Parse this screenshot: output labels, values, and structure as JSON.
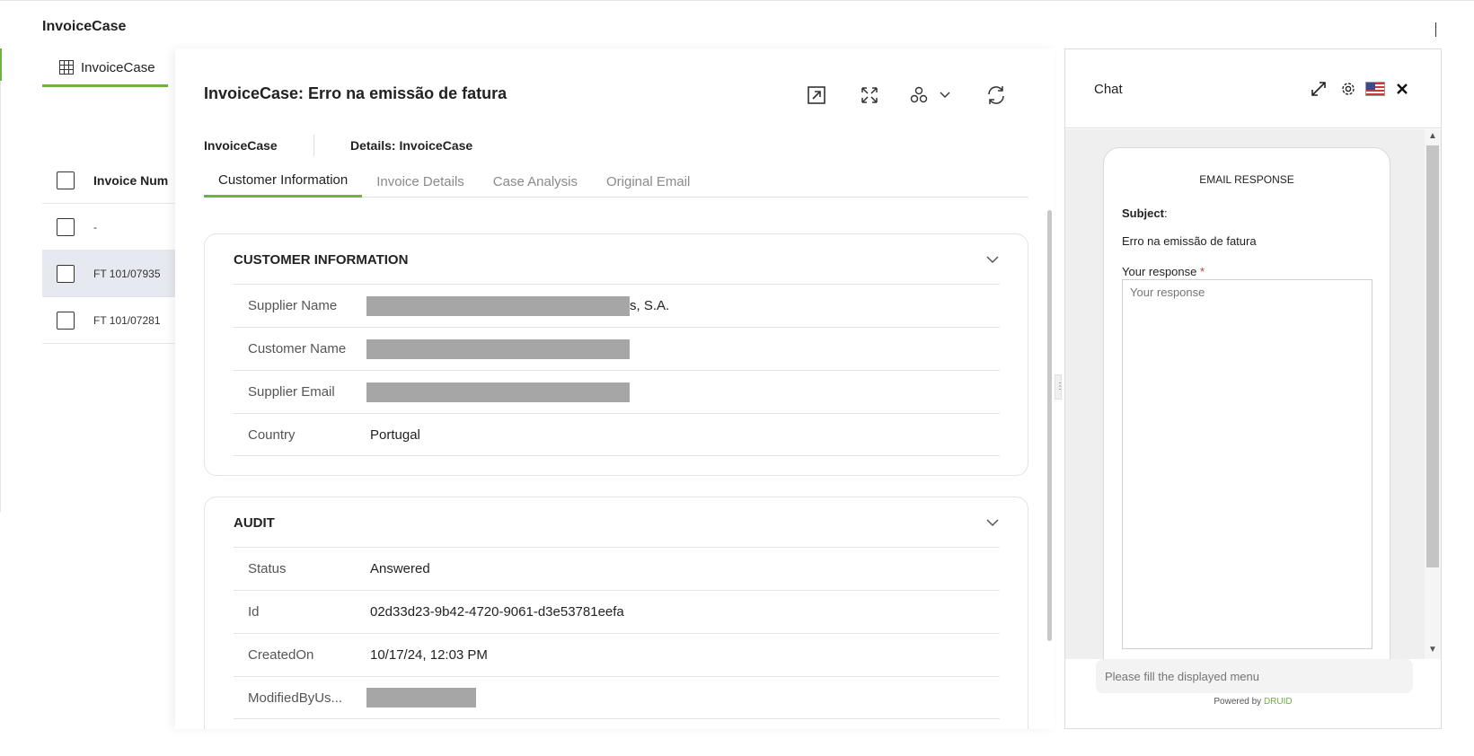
{
  "app": {
    "title": "InvoiceCase"
  },
  "list": {
    "tab_label": "InvoiceCase",
    "column_header": "Invoice Num",
    "rows": [
      "-",
      "FT 101/07935",
      "FT 101/07281"
    ]
  },
  "details": {
    "title": "InvoiceCase: Erro na emissão de fatura",
    "breadcrumb_left": "InvoiceCase",
    "breadcrumb_right": "Details: InvoiceCase",
    "tabs": [
      "Customer Information",
      "Invoice Details",
      "Case Analysis",
      "Original Email"
    ],
    "customer_card": {
      "title": "CUSTOMER INFORMATION",
      "fields": [
        {
          "label": "Supplier Name",
          "value": "s, S.A."
        },
        {
          "label": "Customer Name",
          "value": ""
        },
        {
          "label": "Supplier Email",
          "value": ""
        },
        {
          "label": "Country",
          "value": "Portugal"
        }
      ]
    },
    "audit_card": {
      "title": "AUDIT",
      "fields": [
        {
          "label": "Status",
          "value": "Answered"
        },
        {
          "label": "Id",
          "value": "02d33d23-9b42-4720-9061-d3e53781eefa"
        },
        {
          "label": "CreatedOn",
          "value": "10/17/24, 12:03 PM"
        },
        {
          "label": "ModifiedByUs...",
          "value": ""
        }
      ]
    }
  },
  "chat": {
    "title": "Chat",
    "card_heading": "EMAIL RESPONSE",
    "subject_label": "Subject",
    "subject_colon": ":",
    "subject_value": "Erro na emissão de fatura",
    "response_label": "Your response",
    "required_mark": "*",
    "response_placeholder": "Your response",
    "input_placeholder": "Please fill the displayed menu",
    "powered_by": "Powered by",
    "brand": "DRUID"
  },
  "colors": {
    "accent": "#6db33f",
    "redaction": "#a6a6a6",
    "required": "#d0342c"
  }
}
